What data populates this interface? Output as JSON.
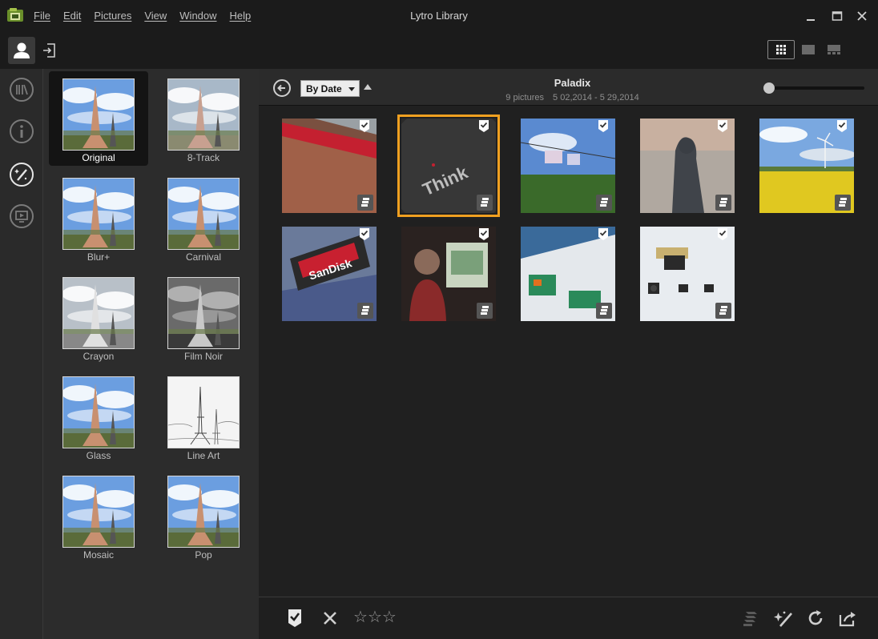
{
  "window": {
    "title": "Lytro Library"
  },
  "menu": [
    "File",
    "Edit",
    "Pictures",
    "View",
    "Window",
    "Help"
  ],
  "effects": {
    "items": [
      {
        "label": "Original",
        "selected": true,
        "style": "color"
      },
      {
        "label": "8-Track",
        "selected": false,
        "style": "faded"
      },
      {
        "label": "Blur+",
        "selected": false,
        "style": "color"
      },
      {
        "label": "Carnival",
        "selected": false,
        "style": "color"
      },
      {
        "label": "Crayon",
        "selected": false,
        "style": "crayon"
      },
      {
        "label": "Film Noir",
        "selected": false,
        "style": "noir"
      },
      {
        "label": "Glass",
        "selected": false,
        "style": "color"
      },
      {
        "label": "Line Art",
        "selected": false,
        "style": "lineart"
      },
      {
        "label": "Mosaic",
        "selected": false,
        "style": "color"
      },
      {
        "label": "Pop",
        "selected": false,
        "style": "color"
      }
    ]
  },
  "content": {
    "sort_label": "By Date",
    "album_title": "Paladix",
    "picture_count": "9 pictures",
    "date_range": "5 02,2014 - 5 29,2014",
    "zoom_level": 0
  },
  "photos": [
    {
      "subject": "red-bench",
      "selected": false
    },
    {
      "subject": "thinkpad-logo",
      "selected": true
    },
    {
      "subject": "street-banners",
      "selected": false
    },
    {
      "subject": "statue",
      "selected": false
    },
    {
      "subject": "rapeseed-field-windmill",
      "selected": false
    },
    {
      "subject": "usb-stick",
      "selected": false
    },
    {
      "subject": "man-at-computer",
      "selected": false
    },
    {
      "subject": "circuit-board",
      "selected": false
    },
    {
      "subject": "electronic-components",
      "selected": false
    }
  ],
  "colors": {
    "accent_selection": "#f0a020",
    "background": "#1e1e1e",
    "panel": "#2c2c2c"
  }
}
